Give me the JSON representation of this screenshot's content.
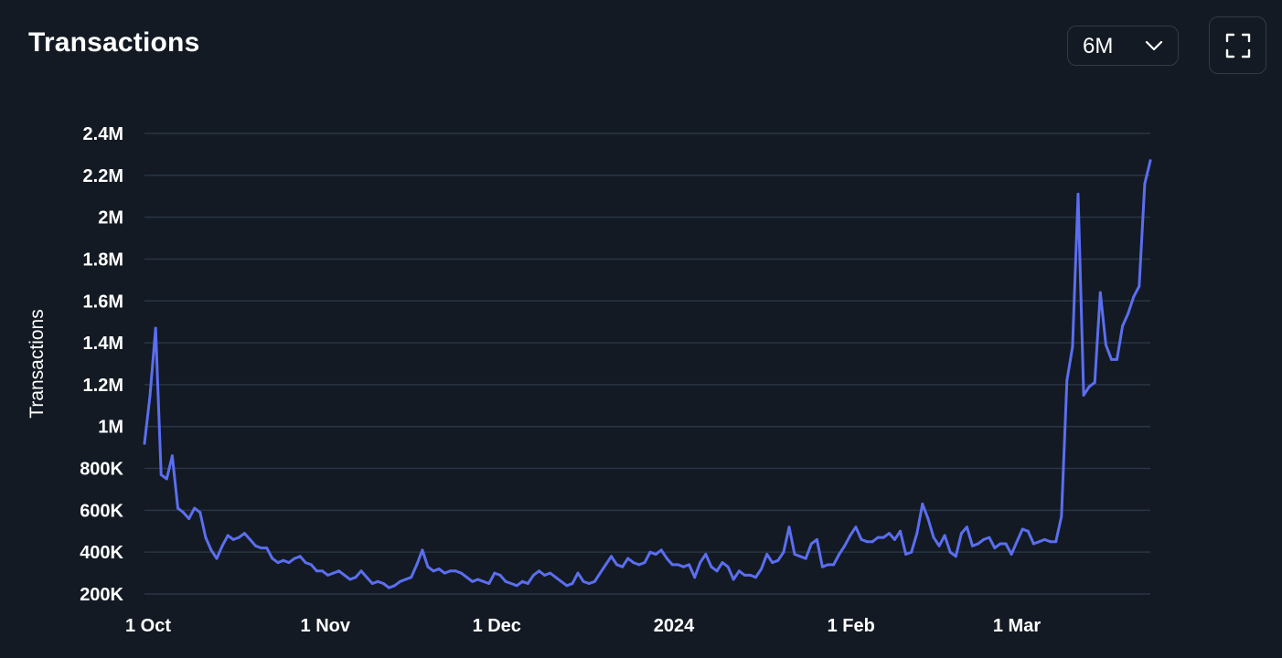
{
  "header": {
    "title": "Transactions",
    "range_select": {
      "value": "6M",
      "icon": "chevron-down-icon"
    },
    "fullscreen_button": {
      "icon": "expand-icon"
    }
  },
  "colors": {
    "background": "#131a23",
    "line": "#5b6ef0",
    "grid": "#2a3545",
    "text": "#ffffff"
  },
  "chart_data": {
    "type": "line",
    "title": "Transactions",
    "xlabel": "",
    "ylabel": "Transactions",
    "ylim": [
      200000,
      2400000
    ],
    "grid": true,
    "y_ticks": [
      {
        "value": 200000,
        "label": "200K"
      },
      {
        "value": 400000,
        "label": "400K"
      },
      {
        "value": 600000,
        "label": "600K"
      },
      {
        "value": 800000,
        "label": "800K"
      },
      {
        "value": 1000000,
        "label": "1M"
      },
      {
        "value": 1200000,
        "label": "1.2M"
      },
      {
        "value": 1400000,
        "label": "1.4M"
      },
      {
        "value": 1600000,
        "label": "1.6M"
      },
      {
        "value": 1800000,
        "label": "1.8M"
      },
      {
        "value": 2000000,
        "label": "2M"
      },
      {
        "value": 2200000,
        "label": "2.2M"
      },
      {
        "value": 2400000,
        "label": "2.4M"
      }
    ],
    "x_start": "2023-10-01",
    "x_end": "2024-03-25",
    "x_ticks": [
      {
        "date": "2023-10-01",
        "label": "1 Oct"
      },
      {
        "date": "2023-11-01",
        "label": "1 Nov"
      },
      {
        "date": "2023-12-01",
        "label": "1 Dec"
      },
      {
        "date": "2024-01-01",
        "label": "2024"
      },
      {
        "date": "2024-02-01",
        "label": "1 Feb"
      },
      {
        "date": "2024-03-01",
        "label": "1 Mar"
      }
    ],
    "series": [
      {
        "values": [
          920000,
          1150000,
          1470000,
          770000,
          750000,
          860000,
          610000,
          590000,
          560000,
          610000,
          590000,
          470000,
          410000,
          370000,
          430000,
          480000,
          460000,
          470000,
          490000,
          460000,
          430000,
          420000,
          420000,
          370000,
          350000,
          360000,
          350000,
          370000,
          380000,
          350000,
          340000,
          310000,
          310000,
          290000,
          300000,
          310000,
          290000,
          270000,
          280000,
          310000,
          280000,
          250000,
          260000,
          250000,
          230000,
          240000,
          260000,
          270000,
          280000,
          340000,
          410000,
          330000,
          310000,
          320000,
          300000,
          310000,
          310000,
          300000,
          280000,
          260000,
          270000,
          260000,
          250000,
          300000,
          290000,
          260000,
          250000,
          240000,
          260000,
          250000,
          290000,
          310000,
          290000,
          300000,
          280000,
          260000,
          240000,
          250000,
          300000,
          260000,
          250000,
          260000,
          300000,
          340000,
          380000,
          340000,
          330000,
          370000,
          350000,
          340000,
          350000,
          400000,
          390000,
          410000,
          370000,
          340000,
          340000,
          330000,
          340000,
          280000,
          350000,
          390000,
          330000,
          310000,
          350000,
          330000,
          270000,
          310000,
          290000,
          290000,
          280000,
          320000,
          390000,
          350000,
          360000,
          400000,
          520000,
          390000,
          380000,
          370000,
          440000,
          460000,
          330000,
          340000,
          340000,
          390000,
          430000,
          480000,
          520000,
          460000,
          450000,
          450000,
          470000,
          470000,
          490000,
          460000,
          500000,
          390000,
          400000,
          490000,
          630000,
          560000,
          470000,
          430000,
          480000,
          400000,
          380000,
          490000,
          520000,
          430000,
          440000,
          460000,
          470000,
          420000,
          440000,
          440000,
          390000,
          450000,
          510000,
          500000,
          440000,
          450000,
          460000,
          450000,
          450000,
          570000,
          1220000,
          1380000,
          2110000,
          1150000,
          1190000,
          1210000,
          1640000,
          1390000,
          1320000,
          1320000,
          1480000,
          1540000,
          1620000,
          1670000,
          2160000,
          2270000
        ]
      }
    ]
  }
}
